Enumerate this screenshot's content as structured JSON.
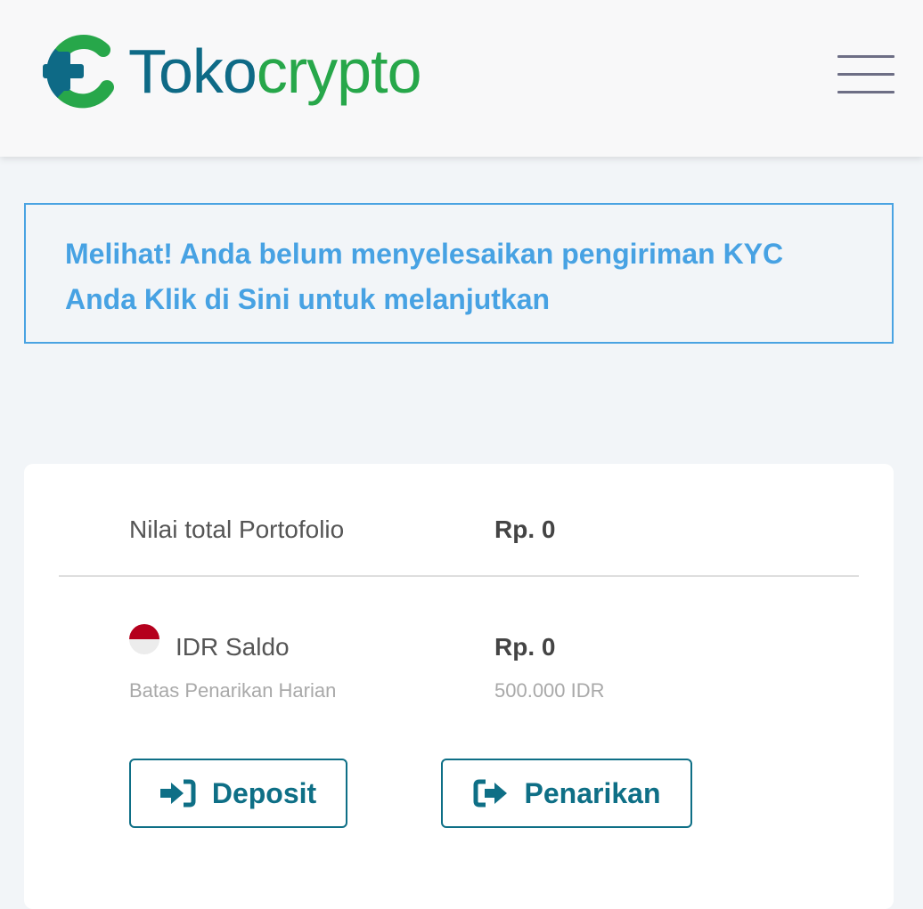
{
  "header": {
    "logo_part1": "Toko",
    "logo_part2": "crypto"
  },
  "kyc_banner": {
    "text_before_link": "Melihat! Anda belum menyelesaikan pengiriman KYC Anda ",
    "link_text": "Klik di Sini untuk melanjutkan"
  },
  "portfolio": {
    "total_label": "Nilai total Portofolio",
    "total_value": "Rp. 0",
    "idr_label": "IDR Saldo",
    "idr_value": "Rp. 0",
    "limit_label": "Batas Penarikan Harian",
    "limit_value": "500.000 IDR"
  },
  "actions": {
    "deposit_label": "Deposit",
    "withdraw_label": "Penarikan"
  },
  "colors": {
    "brand_teal": "#0e6a86",
    "brand_green": "#27a74a",
    "link_blue": "#47a2e3",
    "flag_red": "#b5001d"
  },
  "icons": {
    "logo": "tokocrypto-logo-icon",
    "menu": "hamburger-menu-icon",
    "flag": "indonesia-flag-icon",
    "deposit": "sign-in-icon",
    "withdraw": "sign-out-icon"
  }
}
